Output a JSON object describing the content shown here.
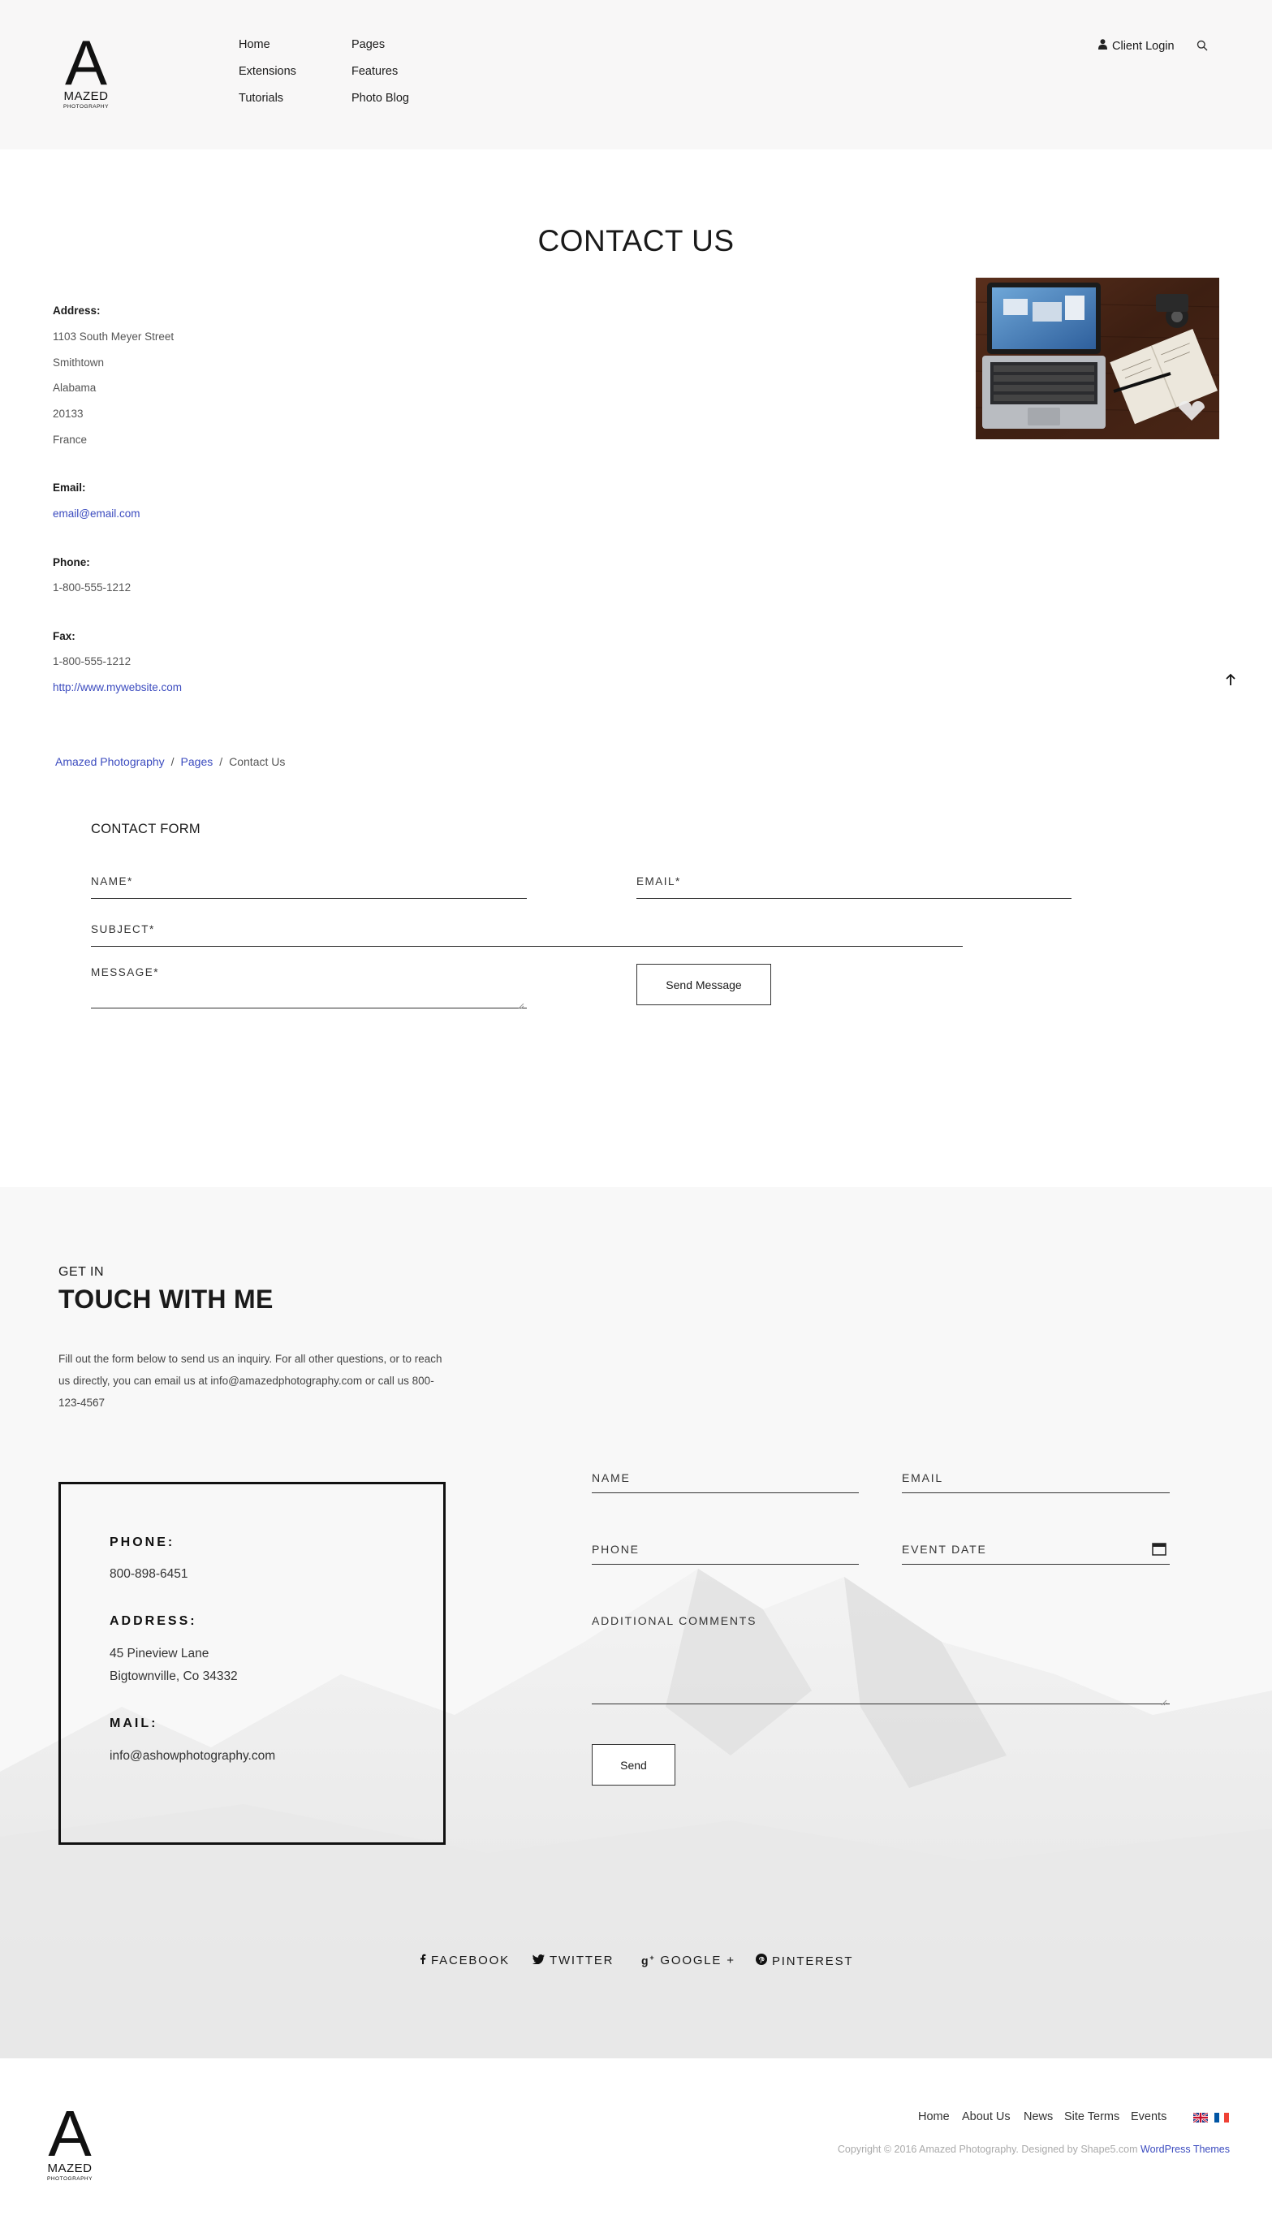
{
  "header": {
    "logo": {
      "letter": "A",
      "word": "MAZED",
      "sub": "PHOTOGRAPHY"
    },
    "nav": [
      "Home",
      "Extensions",
      "Tutorials",
      "Pages",
      "Features",
      "Photo Blog"
    ],
    "client_login": "Client Login",
    "icons": {
      "user": "user-icon",
      "search": "search-icon"
    }
  },
  "contact": {
    "title": "CONTACT US",
    "address_label": "Address:",
    "address_lines": [
      "1103 South Meyer Street",
      "Smithtown",
      "Alabama",
      "20133",
      "France"
    ],
    "email_label": "Email:",
    "email": "email@email.com",
    "phone_label": "Phone:",
    "phone": "1-800-555-1212",
    "fax_label": "Fax:",
    "fax": "1-800-555-1212",
    "website": "http://www.mywebsite.com",
    "back_to_top_icon": "arrow-up-icon"
  },
  "breadcrumb": {
    "items": [
      "Amazed Photography",
      "Pages",
      "Contact Us"
    ],
    "separator": "/"
  },
  "contact_form": {
    "title": "CONTACT FORM",
    "name_placeholder": "NAME*",
    "email_placeholder": "EMAIL*",
    "subject_placeholder": "SUBJECT*",
    "message_placeholder": "MESSAGE*",
    "submit_label": "Send Message"
  },
  "touch": {
    "kicker": "GET IN",
    "title": "TOUCH WITH ME",
    "intro": "Fill out the form below to send us an inquiry. For all other questions, or to reach us directly, you can email us at info@amazedphotography.com or call us 800-123-4567",
    "phone_label": "PHONE:",
    "phone": "800-898-6451",
    "address_label": "ADDRESS:",
    "address_line1": "45 Pineview Lane",
    "address_line2": "Bigtownville, Co 34332",
    "mail_label": "MAIL:",
    "mail": "info@ashowphotography.com",
    "form": {
      "name": "NAME",
      "email": "EMAIL",
      "phone": "PHONE",
      "event_date": "EVENT DATE",
      "comments": "ADDITIONAL COMMENTS",
      "send": "Send"
    },
    "social": [
      {
        "label": "FACEBOOK",
        "icon": "facebook-icon"
      },
      {
        "label": "TWITTER",
        "icon": "twitter-icon"
      },
      {
        "label": "GOOGLE +",
        "icon": "google-plus-icon"
      },
      {
        "label": "PINTEREST",
        "icon": "pinterest-icon"
      }
    ]
  },
  "footer": {
    "logo": {
      "letter": "A",
      "word": "MAZED",
      "sub": "PHOTOGRAPHY"
    },
    "links": [
      "Home",
      "About Us",
      "News",
      "Site Terms",
      "Events"
    ],
    "flags": [
      "uk-flag-icon",
      "france-flag-icon"
    ],
    "copyright": "Copyright © 2016 Amazed Photography. Designed by Shape5.com",
    "themes_link": "WordPress Themes"
  },
  "colors": {
    "link": "#3b4bbf",
    "header_bg": "#f8f7f7",
    "text": "#1a1a1a"
  }
}
